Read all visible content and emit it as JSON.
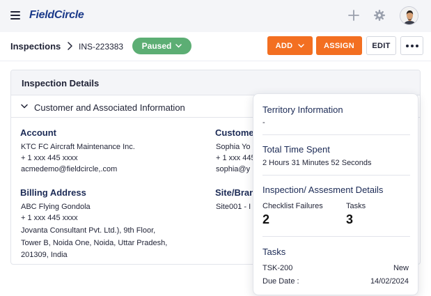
{
  "app": {
    "logo": "FieldCircle"
  },
  "breadcrumb": {
    "root": "Inspections",
    "id": "INS-223383"
  },
  "status": {
    "label": "Paused",
    "color": "#5cae74"
  },
  "actions": {
    "add": "ADD",
    "assign": "ASSIGN",
    "edit": "EDIT"
  },
  "panel": {
    "title": "Inspection Details",
    "section_title": "Customer and Associated Information"
  },
  "account": {
    "label": "Account",
    "name": "KTC FC Aircraft Maintenance Inc.",
    "phone": "+ 1 xxx 445 xxxx",
    "email": "acmedemo@fieldcircle,.com"
  },
  "billing": {
    "label": "Billing Address",
    "lines": [
      "ABC Flying Gondola",
      "+ 1 xxx 445 xxxx",
      "Jovanta Consultant Pvt. Ltd.), 9th Floor,",
      "Tower B, Noida One, Noida, Uttar Pradesh,",
      "201309, India"
    ]
  },
  "customer": {
    "label": "Custome",
    "name": "Sophia Yo",
    "phone": "+ 1 xxx 445",
    "email": "sophia@y"
  },
  "site": {
    "label": "Site/Bran",
    "value": "Site001 - I"
  },
  "popover": {
    "territory": {
      "title": "Territory Information",
      "value": "-"
    },
    "time": {
      "title": "Total Time Spent",
      "value": "2 Hours 31 Minutes 52 Seconds"
    },
    "assessment": {
      "title": "Inspection/ Assesment Details",
      "checklist_label": "Checklist Failures",
      "checklist_value": "2",
      "tasks_label": "Tasks",
      "tasks_value": "3"
    },
    "tasks": {
      "title": "Tasks",
      "id": "TSK-200",
      "status": "New",
      "due_label": "Due Date :",
      "due_value": "14/02/2024"
    }
  },
  "colors": {
    "accent": "#f36f21",
    "navy": "#1b2a55",
    "brand": "#1b3a8a"
  },
  "icons": [
    "menu-icon",
    "plus-icon",
    "gear-icon",
    "avatar",
    "chevron-right-icon",
    "chevron-down-icon",
    "more-icon"
  ]
}
